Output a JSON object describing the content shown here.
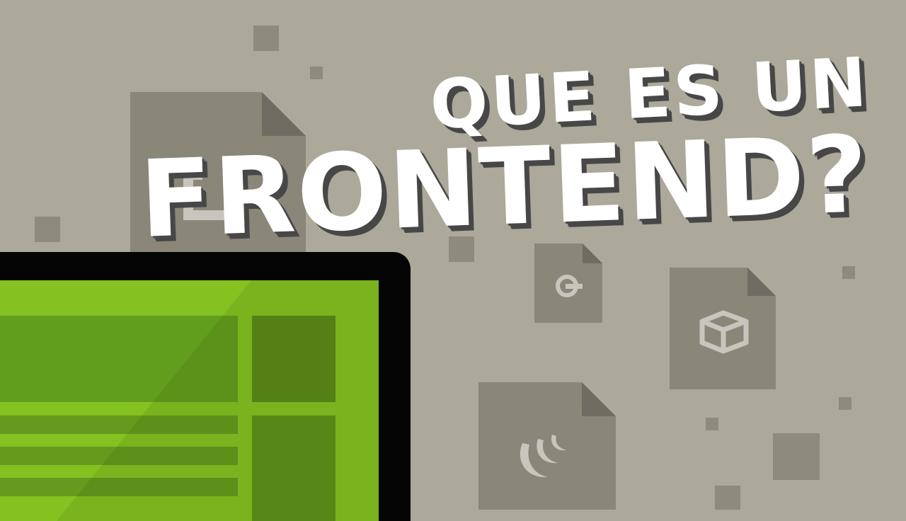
{
  "title": {
    "line1": "QUE ES UN",
    "line2": "FRONTEND?"
  },
  "colors": {
    "background": "#aca89a",
    "square": "#8e8a7d",
    "document": "#8a8678",
    "document_fold": "#6f6c61",
    "icon": "#c8c5bd",
    "title_text": "#ffffff",
    "title_shadow": "#474747",
    "monitor_bezel": "#050505",
    "screen_green": "#84c121",
    "screen_block": "#5b8b18"
  },
  "icons": [
    "html5-icon",
    "code-power-icon",
    "box-icon",
    "jquery-icon"
  ]
}
